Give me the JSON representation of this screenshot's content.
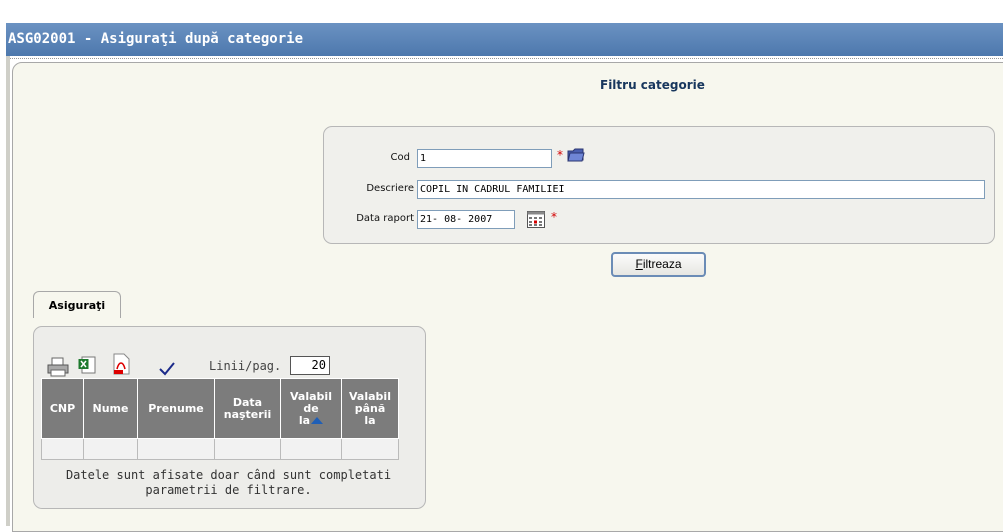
{
  "window": {
    "title": "ASG02001 - Asiguraţi după categorie"
  },
  "filter": {
    "title": "Filtru categorie",
    "cod_label": "Cod",
    "cod_value": "1",
    "descriere_label": "Descriere",
    "descriere_value": "COPIL IN CADRUL FAMILIEI",
    "data_label": "Data raport",
    "data_value": "21- 08- 2007",
    "required_mark": "*",
    "button_label_first": "F",
    "button_label_rest": "iltreaza"
  },
  "tabs": [
    {
      "label": "Asiguraţi"
    }
  ],
  "results": {
    "toolbar": [
      "print-icon",
      "excel-icon",
      "pdf-icon",
      "checkmark-icon"
    ],
    "perpage_label": "Linii/pag.",
    "perpage_value": "20",
    "columns": [
      {
        "l1": "CNP",
        "l2": "",
        "l3": ""
      },
      {
        "l1": "Nume",
        "l2": "",
        "l3": ""
      },
      {
        "l1": "Prenume",
        "l2": "",
        "l3": ""
      },
      {
        "l1": "Data",
        "l2": "naşterii",
        "l3": ""
      },
      {
        "l1": "Valabil",
        "l2": "de",
        "l3": "la"
      },
      {
        "l1": "Valabil",
        "l2": "până",
        "l3": "la"
      }
    ],
    "note_line1": "Datele sunt afisate doar când sunt completati",
    "note_line2": "parametrii de filtrare."
  },
  "colors": {
    "titlebar": "#5a84b8",
    "header": "#7c7c7c",
    "panel": "#f7f7ee",
    "required": "#d40000"
  }
}
